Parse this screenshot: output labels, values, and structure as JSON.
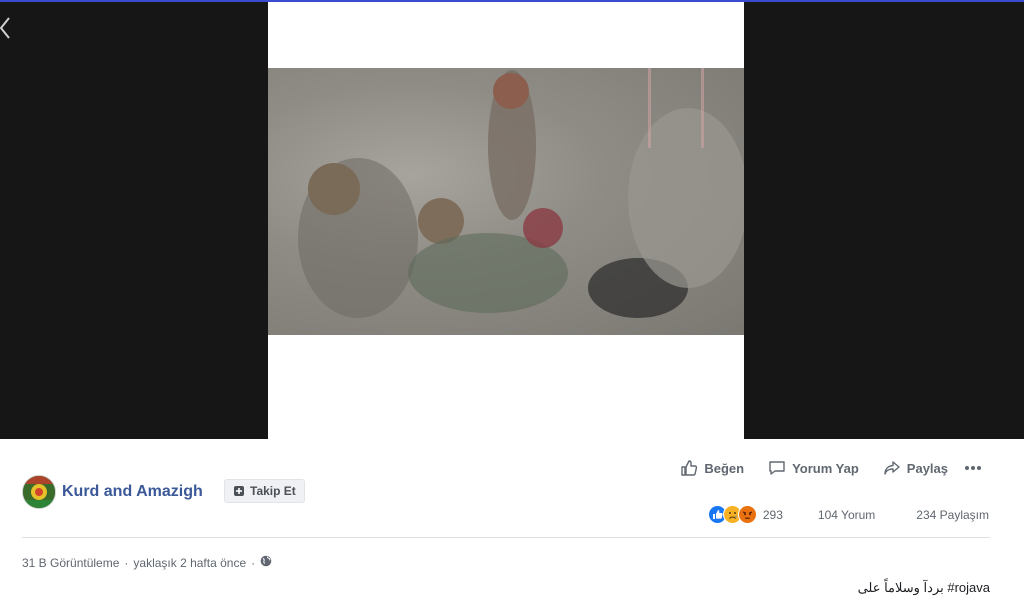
{
  "nav": {
    "back_icon": "chevron-left-icon"
  },
  "page": {
    "name": "Kurd and Amazigh",
    "follow_label": "Takip Et",
    "follow_icon": "add-follow-icon"
  },
  "actions": {
    "like_label": "Beğen",
    "comment_label": "Yorum Yap",
    "share_label": "Paylaş",
    "more_icon": "more-horizontal-icon"
  },
  "stats": {
    "reaction_icons": [
      "like-reaction-icon",
      "sad-reaction-icon",
      "angry-reaction-icon"
    ],
    "reaction_count": "293",
    "comments": "104 Yorum",
    "shares": "234 Paylaşım"
  },
  "meta": {
    "views": "31 B Görüntüleme",
    "separator": "·",
    "time": "yaklaşık 2 hafta önce",
    "audience_icon": "globe-icon"
  },
  "caption": "بردآ وسلاماً على #rojava",
  "colors": {
    "link": "#3b5998",
    "muted": "#606770",
    "like_blue": "#1877f2",
    "angry": "#e9710f",
    "sad": "#f7b125"
  }
}
